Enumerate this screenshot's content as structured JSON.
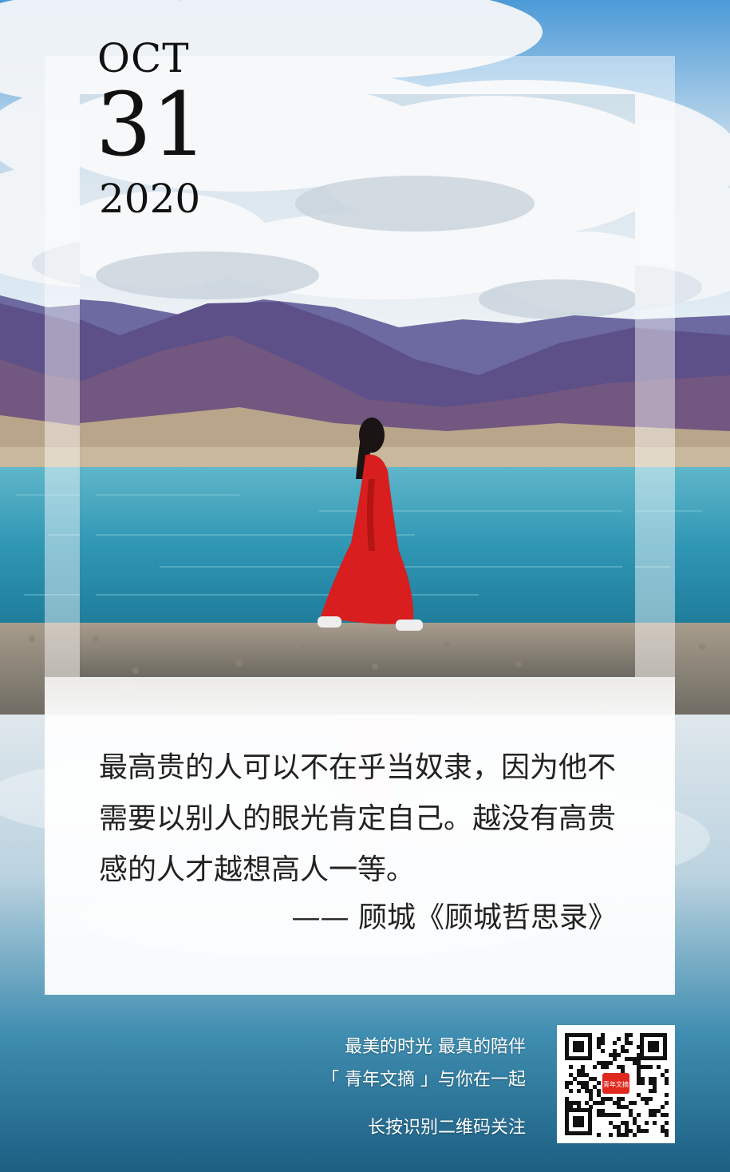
{
  "date": {
    "month": "OCT",
    "day": "31",
    "year": "2020"
  },
  "quote": {
    "lines": [
      "最高贵的人可以不在乎当奴隶，因为他不",
      "需要以别人的眼光肯定自己。越没有高贵",
      "感的人才越想高人一等。"
    ],
    "attribution": "—— 顾城《顾城哲思录》"
  },
  "footer": {
    "line1": "最美的时光  最真的陪伴",
    "line2": "「 青年文摘 」与你在一起",
    "line3": "长按识别二维码关注"
  },
  "qr": {
    "badge": "青年文摘"
  },
  "colors": {
    "sky": "#3a8fd0",
    "mountain": "#5a4f8a",
    "lake": "#2a8aa8",
    "dress": "#d81e1e",
    "text": "#222222"
  }
}
